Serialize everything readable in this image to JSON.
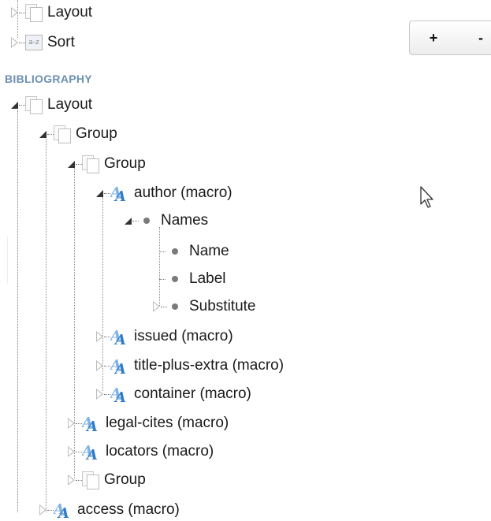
{
  "zoom": {
    "plus": "+",
    "minus": "-"
  },
  "top_items": [
    {
      "label": "Layout",
      "icon": "layout-icon"
    },
    {
      "label": "Sort",
      "icon": "sort-icon",
      "icon_text": "a-z"
    }
  ],
  "section_title": "BIBLIOGRAPHY",
  "tree": [
    {
      "label": "Layout"
    },
    {
      "label": "Group"
    },
    {
      "label": "Group"
    },
    {
      "label": "author (macro)"
    },
    {
      "label": "Names"
    },
    {
      "label": "Name"
    },
    {
      "label": "Label"
    },
    {
      "label": "Substitute"
    },
    {
      "label": "issued (macro)"
    },
    {
      "label": "title-plus-extra (macro)"
    },
    {
      "label": "container (macro)"
    },
    {
      "label": "legal-cites (macro)"
    },
    {
      "label": "locators (macro)"
    },
    {
      "label": "Group"
    },
    {
      "label": "access (macro)"
    }
  ],
  "colors": {
    "section": "#6b8fb2",
    "macro_icon": "#3c87cf"
  }
}
